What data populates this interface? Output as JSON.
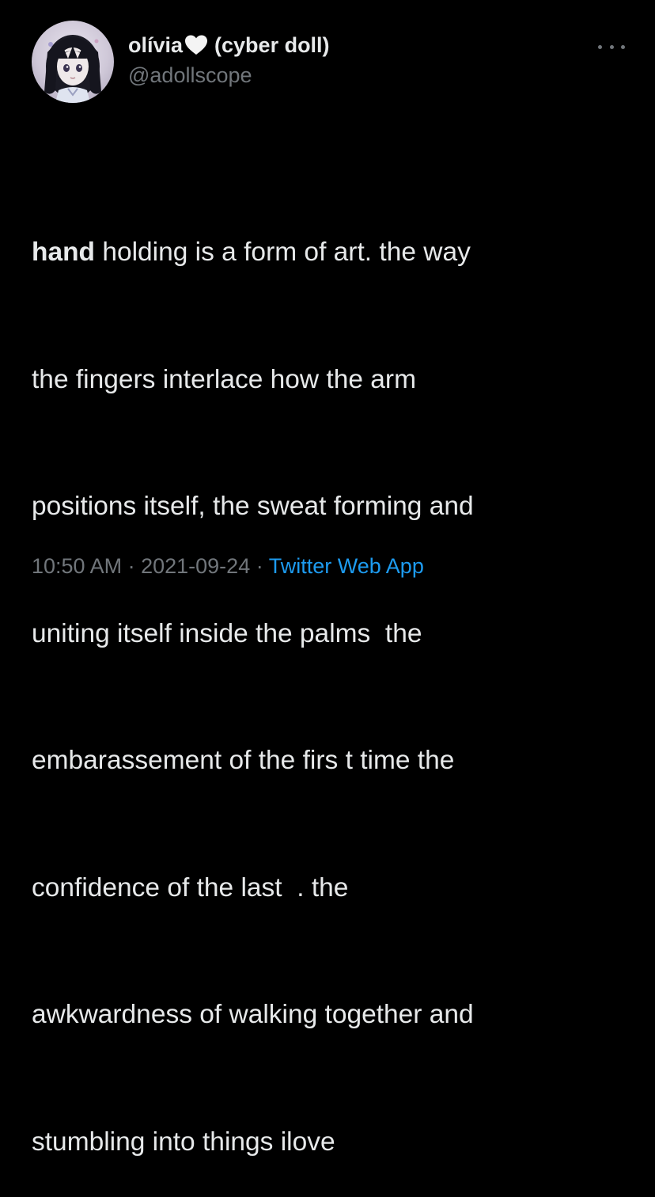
{
  "author": {
    "display_name": "olívia",
    "heart_emoji": "🤍",
    "name_suffix": "(cyber doll)",
    "handle": "@adollscope",
    "avatar_icon": "anime-girl-avatar"
  },
  "menu": {
    "icon": "more-horizontal-icon"
  },
  "tweet": {
    "first_word": "hand",
    "lines": [
      " holding is a form of art. the way",
      "the fingers interlace how the arm",
      "positions itself, the sweat forming and",
      "uniting itself inside the palms  the",
      "embarassement of the firs t time the",
      "confidence of the last  . the",
      "awkwardness of walking together and",
      "stumbling into things ilove"
    ]
  },
  "meta": {
    "time": "10:50 AM",
    "separator": "·",
    "date": "2021-09-24",
    "source": "Twitter Web App"
  },
  "colors": {
    "background": "#000000",
    "text": "#e7e9ea",
    "muted": "#71767b",
    "link": "#1d9bf0"
  }
}
